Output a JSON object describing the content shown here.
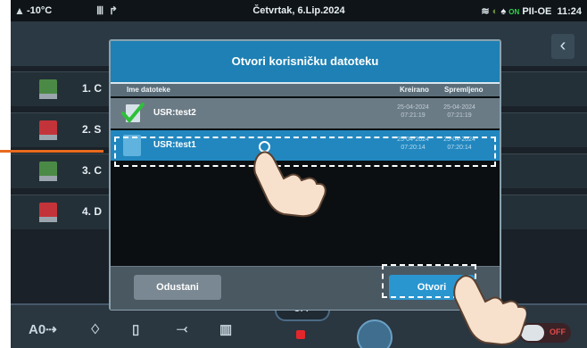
{
  "status_bar": {
    "outdoor_temp": "-10°C",
    "date": "Četvrtak, 6.Lip.2024",
    "on_label": "ON",
    "mode": "PII-OE",
    "time": "11:24"
  },
  "background_menu": {
    "items": [
      {
        "number": "1. C"
      },
      {
        "number": "2. S"
      },
      {
        "number": "3. C"
      },
      {
        "number": "4. D"
      }
    ],
    "back_glyph": "‹"
  },
  "dialog": {
    "title": "Otvori korisničku datoteku",
    "columns": {
      "name": "Ime datoteke",
      "created": "Kreirano",
      "saved": "Spremljeno"
    },
    "files": [
      {
        "name": "USR:test2",
        "created_date": "25-04-2024",
        "created_time": "07:21:19",
        "saved_date": "25-04-2024",
        "saved_time": "07:21:19",
        "selected": false
      },
      {
        "name": "USR:test1",
        "created_date": "25-04-2024",
        "created_time": "07:20:14",
        "saved_date": "25-04-2024",
        "saved_time": "07:20:14",
        "selected": true
      }
    ],
    "cancel_label": "Odustani",
    "open_label": "Otvori"
  },
  "bottom_bar": {
    "off_label": "OFF",
    "toggle_label": "OFF"
  },
  "colors": {
    "header_blue": "#1e80b4",
    "selected_row": "#2287bf",
    "annotation_orange": "#e86a1e"
  }
}
